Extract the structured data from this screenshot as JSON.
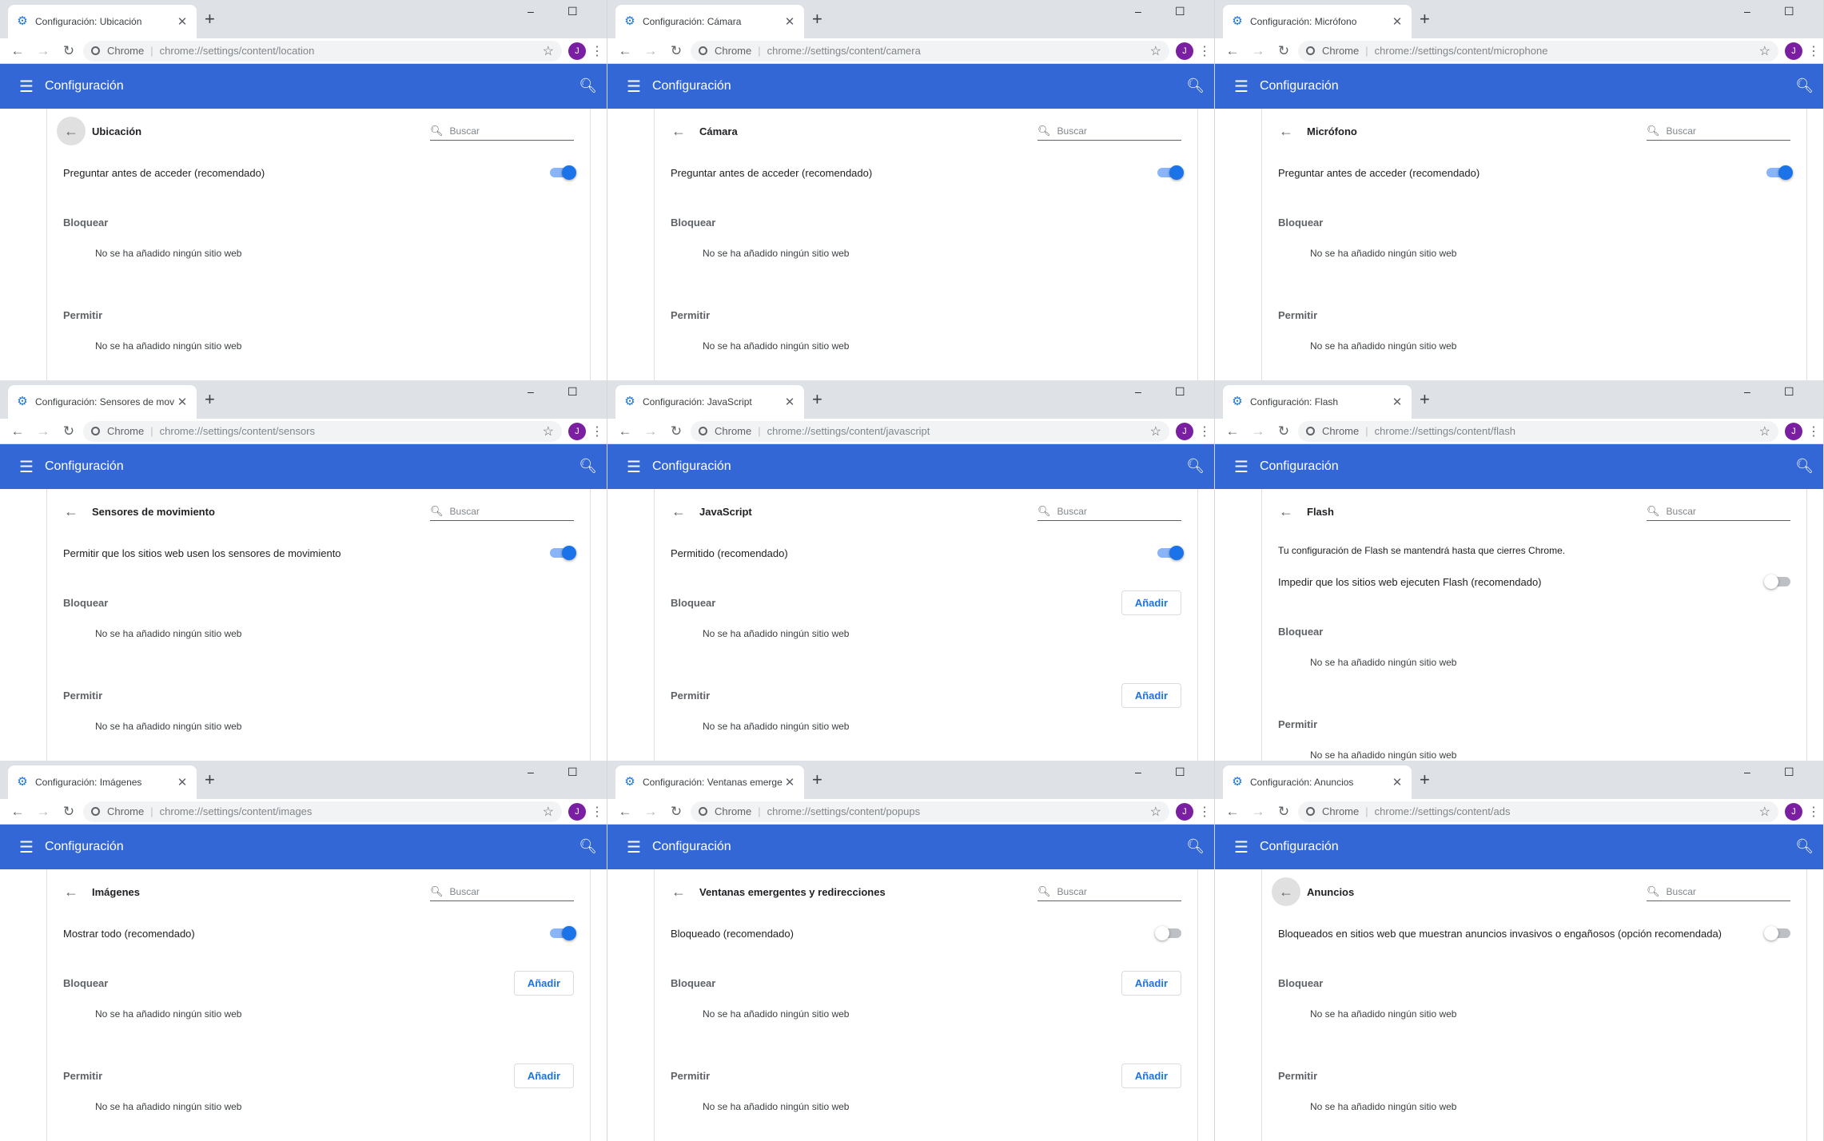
{
  "windows": [
    {
      "tab": "Configuración: Ubicación",
      "url": "chrome://settings/content/location",
      "app": "Configuración",
      "title": "Ubicación",
      "search": "Buscar",
      "omni_label": "Chrome",
      "avatar": "J",
      "back_hi": true,
      "note": "",
      "toggle_label": "Preguntar antes de acceder (recomendado)",
      "toggle_on": true,
      "block_label": "Bloquear",
      "allow_label": "Permitir",
      "add": "",
      "empty": "No se ha añadido ningún sitio web"
    },
    {
      "tab": "Configuración: Cámara",
      "url": "chrome://settings/content/camera",
      "app": "Configuración",
      "title": "Cámara",
      "search": "Buscar",
      "omni_label": "Chrome",
      "avatar": "J",
      "back_hi": false,
      "note": "",
      "toggle_label": "Preguntar antes de acceder (recomendado)",
      "toggle_on": true,
      "block_label": "Bloquear",
      "allow_label": "Permitir",
      "add": "",
      "empty": "No se ha añadido ningún sitio web"
    },
    {
      "tab": "Configuración: Micrófono",
      "url": "chrome://settings/content/microphone",
      "app": "Configuración",
      "title": "Micrófono",
      "search": "Buscar",
      "omni_label": "Chrome",
      "avatar": "J",
      "back_hi": false,
      "note": "",
      "toggle_label": "Preguntar antes de acceder (recomendado)",
      "toggle_on": true,
      "block_label": "Bloquear",
      "allow_label": "Permitir",
      "add": "",
      "empty": "No se ha añadido ningún sitio web"
    },
    {
      "tab": "Configuración: Sensores de mov",
      "url": "chrome://settings/content/sensors",
      "app": "Configuración",
      "title": "Sensores de movimiento",
      "search": "Buscar",
      "omni_label": "Chrome",
      "avatar": "J",
      "back_hi": false,
      "note": "",
      "toggle_label": "Permitir que los sitios web usen los sensores de movimiento",
      "toggle_on": true,
      "block_label": "Bloquear",
      "allow_label": "Permitir",
      "add": "",
      "empty": "No se ha añadido ningún sitio web"
    },
    {
      "tab": "Configuración: JavaScript",
      "url": "chrome://settings/content/javascript",
      "app": "Configuración",
      "title": "JavaScript",
      "search": "Buscar",
      "omni_label": "Chrome",
      "avatar": "J",
      "back_hi": false,
      "note": "",
      "toggle_label": "Permitido (recomendado)",
      "toggle_on": true,
      "block_label": "Bloquear",
      "allow_label": "Permitir",
      "add": "Añadir",
      "empty": "No se ha añadido ningún sitio web"
    },
    {
      "tab": "Configuración: Flash",
      "url": "chrome://settings/content/flash",
      "app": "Configuración",
      "title": "Flash",
      "search": "Buscar",
      "omni_label": "Chrome",
      "avatar": "J",
      "back_hi": false,
      "note": "Tu configuración de Flash se mantendrá hasta que cierres Chrome.",
      "toggle_label": "Impedir que los sitios web ejecuten Flash (recomendado)",
      "toggle_on": false,
      "block_label": "Bloquear",
      "allow_label": "Permitir",
      "add": "",
      "empty": "No se ha añadido ningún sitio web"
    },
    {
      "tab": "Configuración: Imágenes",
      "url": "chrome://settings/content/images",
      "app": "Configuración",
      "title": "Imágenes",
      "search": "Buscar",
      "omni_label": "Chrome",
      "avatar": "J",
      "back_hi": false,
      "note": "",
      "toggle_label": "Mostrar todo (recomendado)",
      "toggle_on": true,
      "block_label": "Bloquear",
      "allow_label": "Permitir",
      "add": "Añadir",
      "empty": "No se ha añadido ningún sitio web"
    },
    {
      "tab": "Configuración: Ventanas emerge",
      "url": "chrome://settings/content/popups",
      "app": "Configuración",
      "title": "Ventanas emergentes y redirecciones",
      "search": "Buscar",
      "omni_label": "Chrome",
      "avatar": "J",
      "back_hi": false,
      "note": "",
      "toggle_label": "Bloqueado (recomendado)",
      "toggle_on": false,
      "block_label": "Bloquear",
      "allow_label": "Permitir",
      "add": "Añadir",
      "empty": "No se ha añadido ningún sitio web"
    },
    {
      "tab": "Configuración: Anuncios",
      "url": "chrome://settings/content/ads",
      "app": "Configuración",
      "title": "Anuncios",
      "search": "Buscar",
      "omni_label": "Chrome",
      "avatar": "J",
      "back_hi": true,
      "note": "",
      "toggle_label": "Bloqueados en sitios web que muestran anuncios invasivos o engañosos (opción recomendada)",
      "toggle_on": false,
      "block_label": "Bloquear",
      "allow_label": "Permitir",
      "add": "",
      "empty": "No se ha añadido ningún sitio web"
    }
  ],
  "colors": {
    "appbar": "#3367d6",
    "accent": "#1a73e8",
    "avatar": "#7b1fa2"
  }
}
